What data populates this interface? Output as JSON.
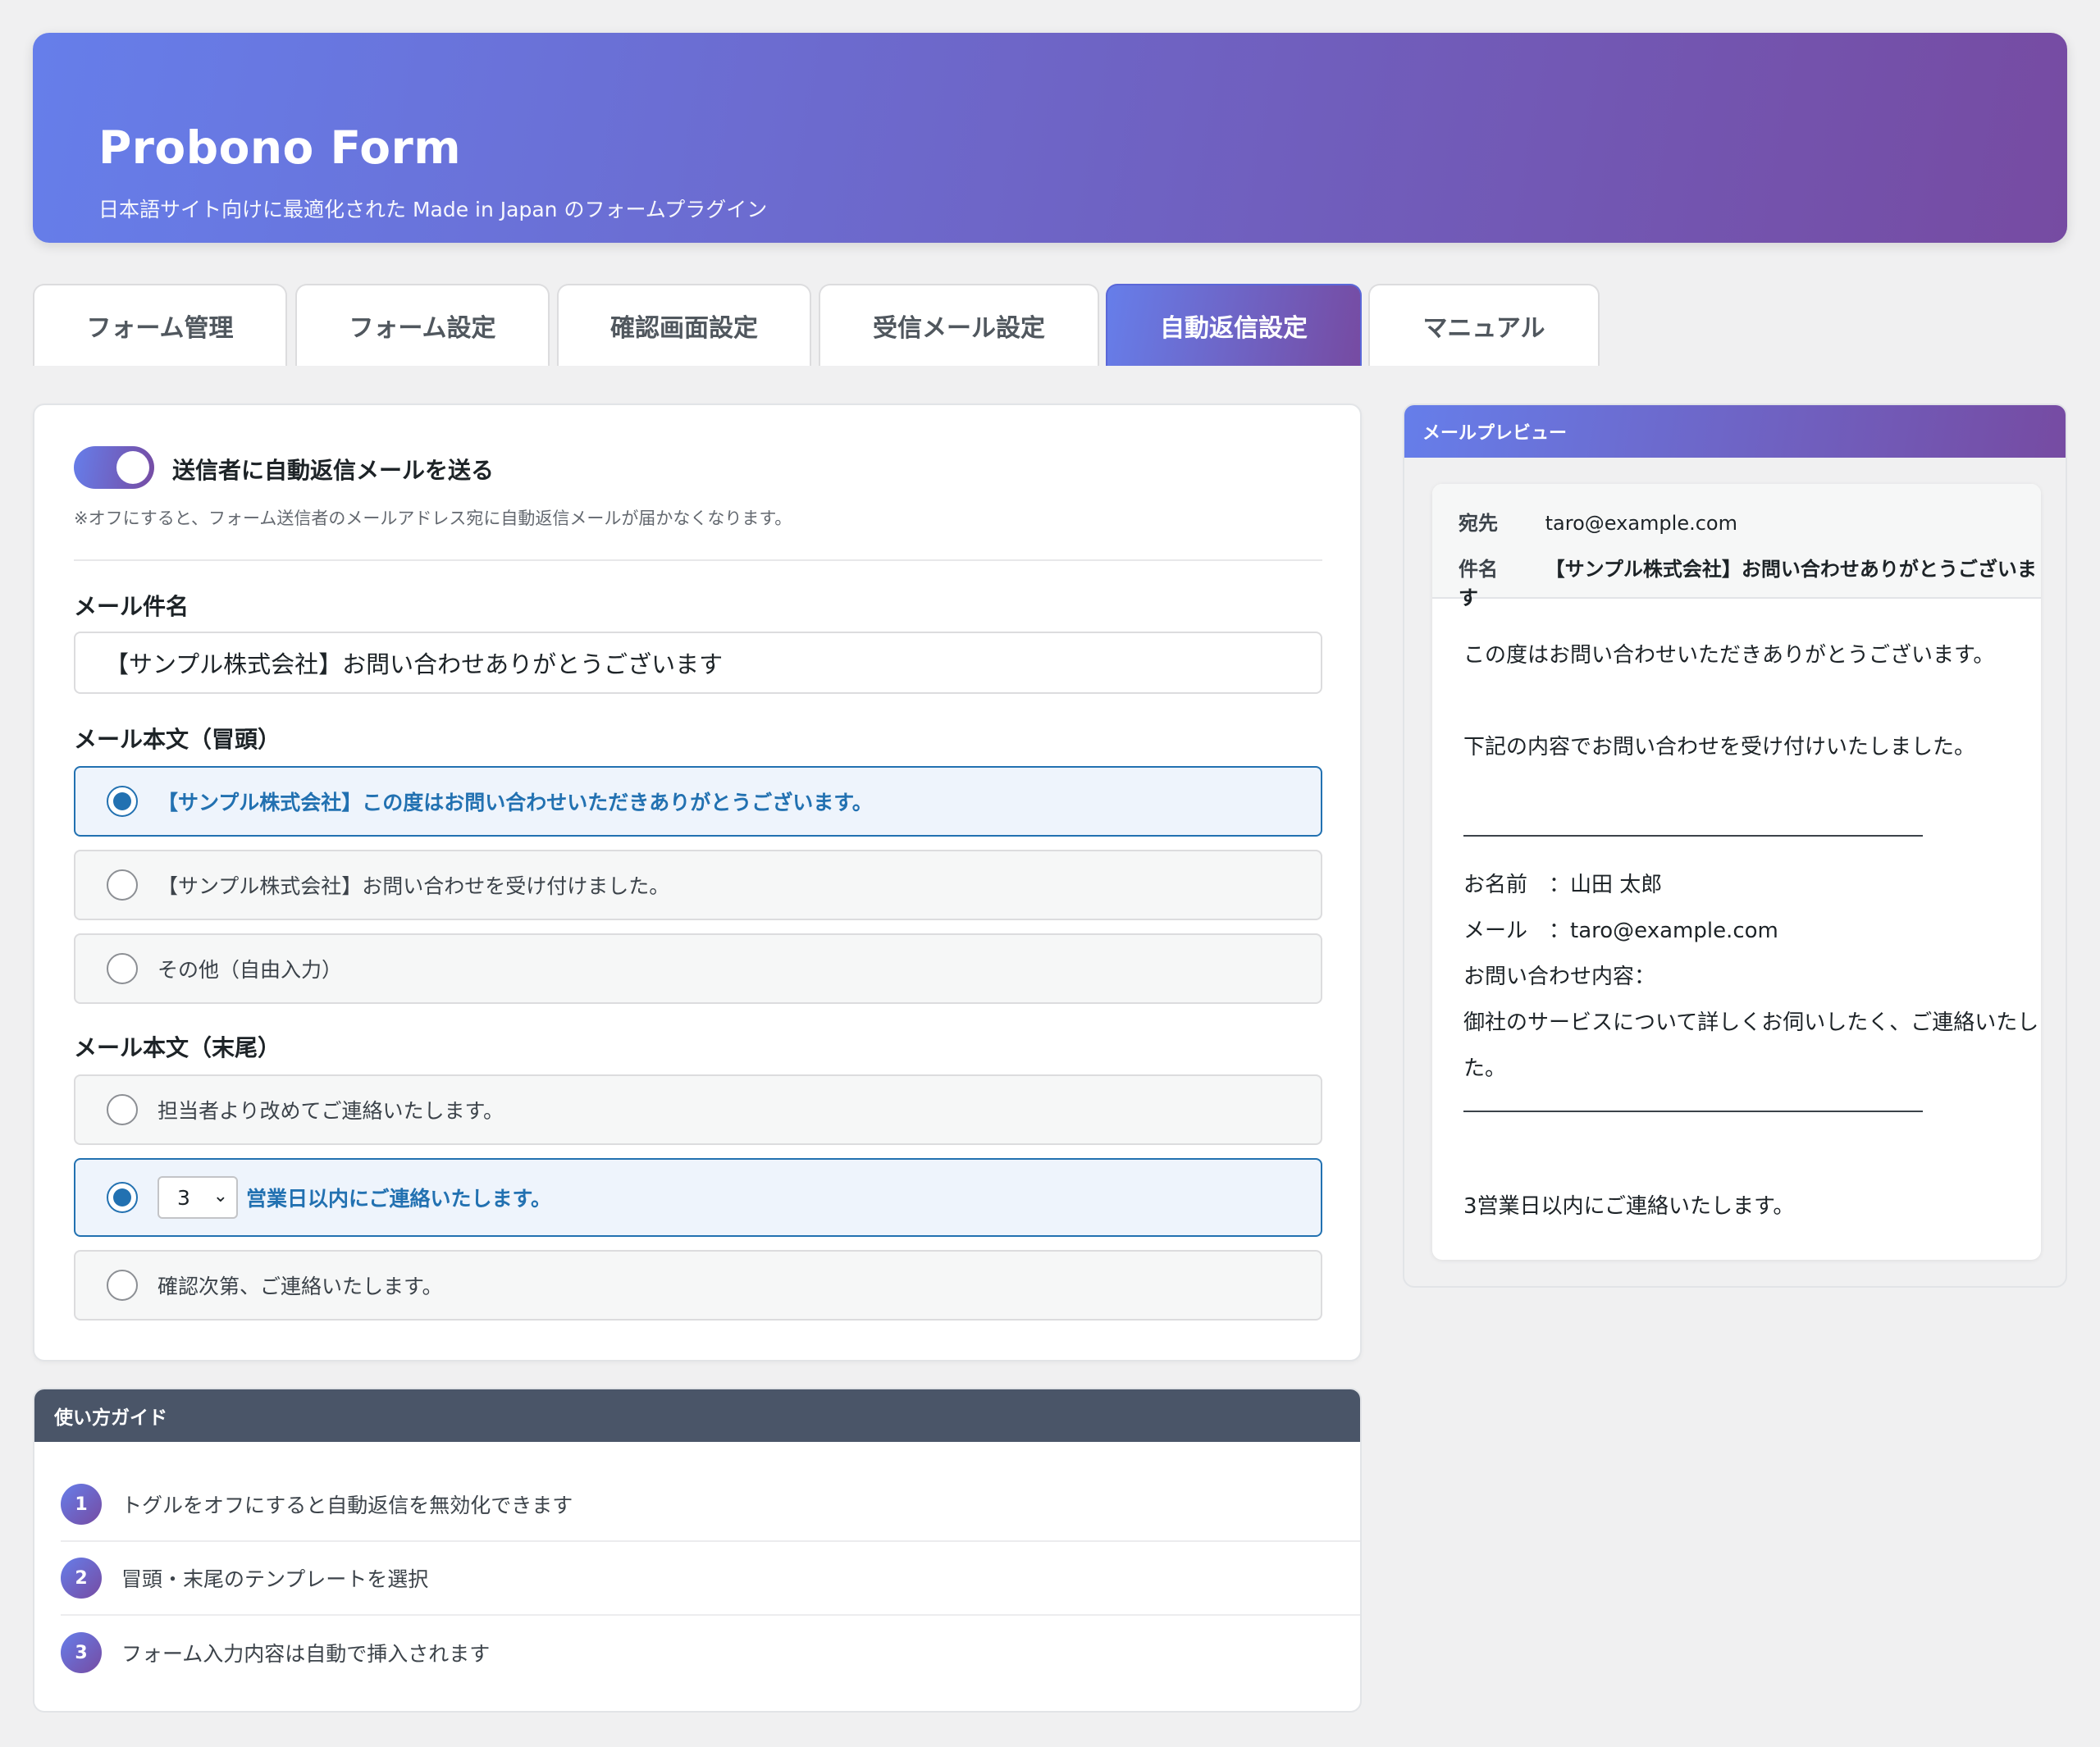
{
  "header": {
    "title": "Probono Form",
    "subtitle": "日本語サイト向けに最適化された Made in Japan のフォームプラグイン"
  },
  "tabs": [
    {
      "label": "フォーム管理",
      "active": false
    },
    {
      "label": "フォーム設定",
      "active": false
    },
    {
      "label": "確認画面設定",
      "active": false
    },
    {
      "label": "受信メール設定",
      "active": false
    },
    {
      "label": "自動返信設定",
      "active": true
    },
    {
      "label": "マニュアル",
      "active": false
    }
  ],
  "settings": {
    "toggle_label": "送信者に自動返信メールを送る",
    "toggle_on": true,
    "toggle_note": "※オフにすると、フォーム送信者のメールアドレス宛に自動返信メールが届かなくなります。",
    "subject_label": "メール件名",
    "subject_value": "【サンプル株式会社】お問い合わせありがとうございます",
    "opening_label": "メール本文（冒頭）",
    "opening_options": [
      {
        "label": "【サンプル株式会社】この度はお問い合わせいただきありがとうございます。",
        "selected": true
      },
      {
        "label": "【サンプル株式会社】お問い合わせを受け付けました。",
        "selected": false
      },
      {
        "label": "その他（自由入力）",
        "selected": false
      }
    ],
    "closing_label": "メール本文（末尾）",
    "closing_options": [
      {
        "label": "担当者より改めてご連絡いたします。",
        "selected": false
      },
      {
        "select_value": "3",
        "label": "営業日以内にご連絡いたします。",
        "selected": true
      },
      {
        "label": "確認次第、ご連絡いたします。",
        "selected": false
      }
    ]
  },
  "guide": {
    "title": "使い方ガイド",
    "steps": [
      {
        "num": "1",
        "text": "トグルをオフにすると自動返信を無効化できます"
      },
      {
        "num": "2",
        "text": "冒頭・末尾のテンプレートを選択"
      },
      {
        "num": "3",
        "text": "フォーム入力内容は自動で挿入されます"
      }
    ]
  },
  "preview": {
    "title": "メールプレビュー",
    "to_key": "宛先",
    "to_value": "taro@example.com",
    "subject_key": "件名",
    "subject_value": "【サンプル株式会社】お問い合わせありがとうございます",
    "body": {
      "greeting": "この度はお問い合わせいただきありがとうございます。",
      "received": "下記の内容でお問い合わせを受け付けいたしました。",
      "name_line": "お名前　：山田 太郎",
      "mail_line": "メール　：taro@example.com",
      "inquiry_label": "お問い合わせ内容：",
      "inquiry_line1": "御社のサービスについて詳しくお伺いしたく、ご連絡いたしまし",
      "inquiry_line2": "た。",
      "closing": "3営業日以内にご連絡いたします。"
    }
  },
  "colors": {
    "gradient_start": "#667eea",
    "gradient_end": "#764ba2",
    "accent_blue": "#2271b1",
    "guide_header": "#4a5568"
  }
}
